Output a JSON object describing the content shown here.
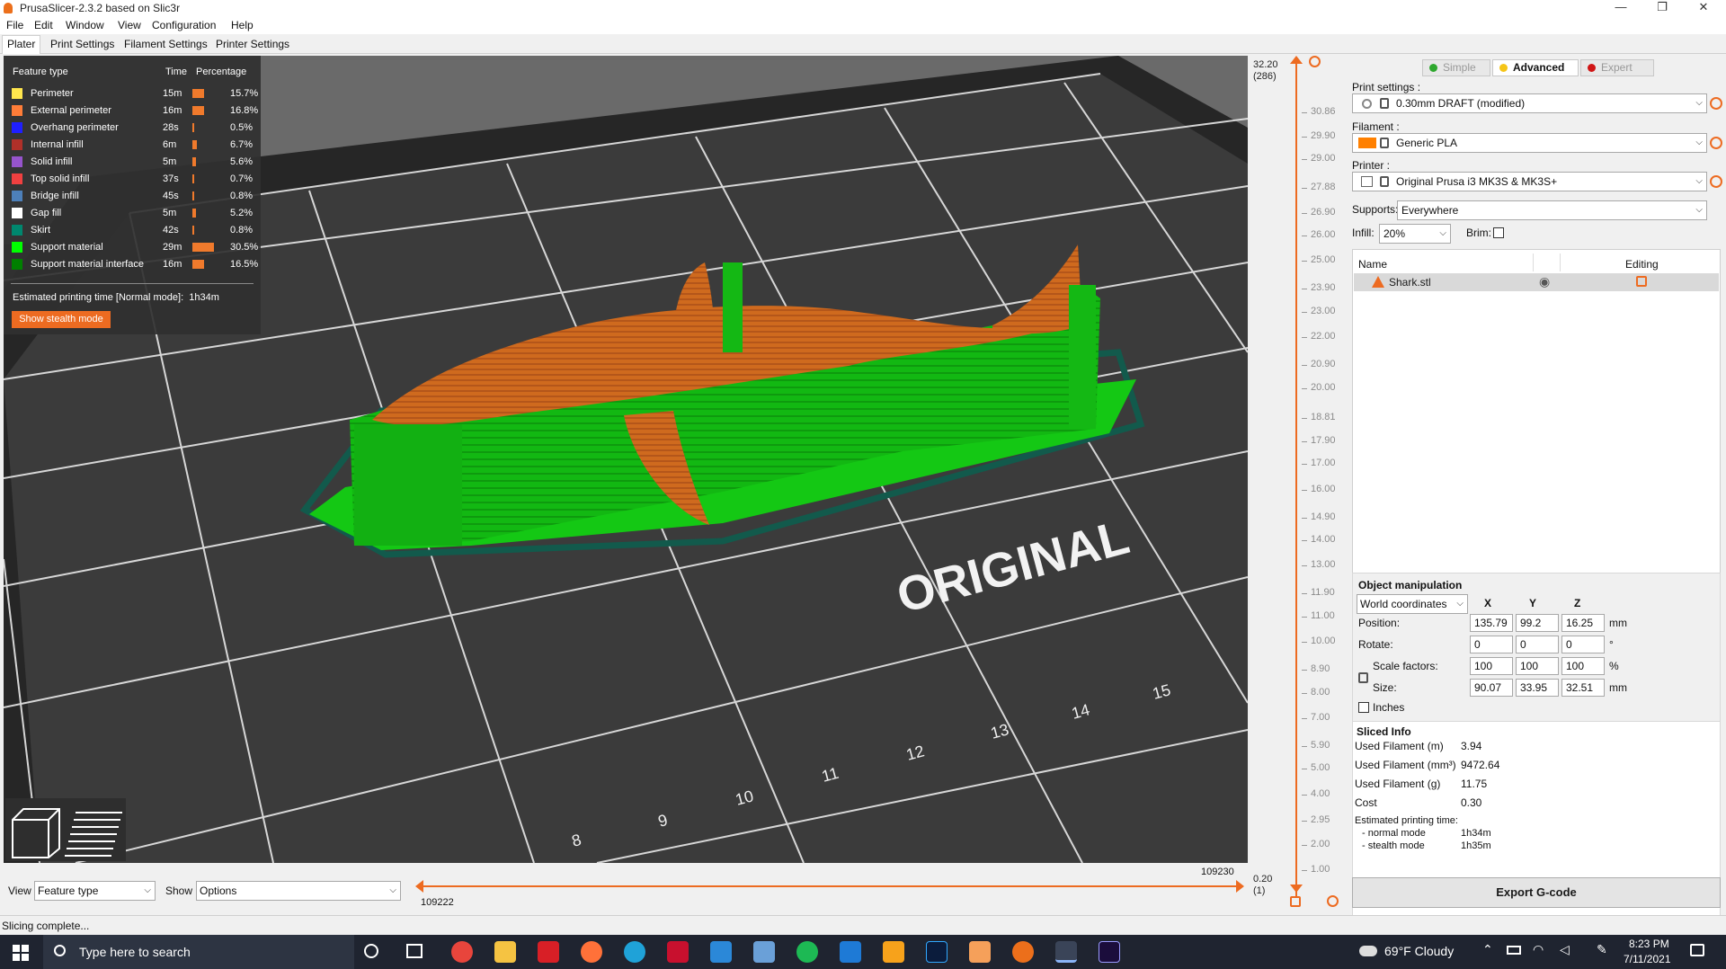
{
  "window": {
    "title": "PrusaSlicer-2.3.2 based on Slic3r",
    "controls": [
      "—",
      "❐",
      "✕"
    ]
  },
  "menu": [
    "File",
    "Edit",
    "Window",
    "View",
    "Configuration",
    "Help"
  ],
  "tabs": [
    "Plater",
    "Print Settings",
    "Filament Settings",
    "Printer Settings"
  ],
  "legend": {
    "headers": {
      "feature": "Feature type",
      "time": "Time",
      "percentage": "Percentage"
    },
    "rows": [
      {
        "name": "Perimeter",
        "time": "15m",
        "pct": "15.7%",
        "frac": 0.157,
        "color": "#ffe64d"
      },
      {
        "name": "External perimeter",
        "time": "16m",
        "pct": "16.8%",
        "frac": 0.168,
        "color": "#ff7d38"
      },
      {
        "name": "Overhang perimeter",
        "time": "28s",
        "pct": "0.5%",
        "frac": 0.005,
        "color": "#1f1fff"
      },
      {
        "name": "Internal infill",
        "time": "6m",
        "pct": "6.7%",
        "frac": 0.067,
        "color": "#b03029"
      },
      {
        "name": "Solid infill",
        "time": "5m",
        "pct": "5.6%",
        "frac": 0.056,
        "color": "#9654cc"
      },
      {
        "name": "Top solid infill",
        "time": "37s",
        "pct": "0.7%",
        "frac": 0.007,
        "color": "#f04040"
      },
      {
        "name": "Bridge infill",
        "time": "45s",
        "pct": "0.8%",
        "frac": 0.008,
        "color": "#4d80ba"
      },
      {
        "name": "Gap fill",
        "time": "5m",
        "pct": "5.2%",
        "frac": 0.052,
        "color": "#ffffff"
      },
      {
        "name": "Skirt",
        "time": "42s",
        "pct": "0.8%",
        "frac": 0.008,
        "color": "#00876e"
      },
      {
        "name": "Support material",
        "time": "29m",
        "pct": "30.5%",
        "frac": 0.305,
        "color": "#00ff00"
      },
      {
        "name": "Support material interface",
        "time": "16m",
        "pct": "16.5%",
        "frac": 0.165,
        "color": "#008000"
      }
    ],
    "estimated_label": "Estimated printing time [Normal mode]:",
    "estimated_value": "1h34m",
    "stealth_button": "Show stealth mode"
  },
  "viewport": {
    "bed_text": "ORIGINAL",
    "bed_numbers": [
      "8",
      "9",
      "10",
      "11",
      "12",
      "13",
      "14",
      "15"
    ]
  },
  "layer_slider": {
    "top_value": "32.20",
    "top_layer": "(286)",
    "bottom_value": "0.20",
    "bottom_layer": "(1)",
    "ticks": [
      "30.86",
      "29.90",
      "29.00",
      "27.88",
      "26.90",
      "26.00",
      "25.00",
      "23.90",
      "23.00",
      "22.00",
      "20.90",
      "20.00",
      "18.81",
      "17.90",
      "17.00",
      "16.00",
      "14.90",
      "14.00",
      "13.00",
      "11.90",
      "11.00",
      "10.00",
      "8.90",
      "8.00",
      "7.00",
      "5.90",
      "5.00",
      "4.00",
      "2.95",
      "2.00",
      "1.00"
    ]
  },
  "mode_buttons": [
    {
      "label": "Simple",
      "color": "#2ea82e",
      "active": false
    },
    {
      "label": "Advanced",
      "color": "#f5c518",
      "active": true
    },
    {
      "label": "Expert",
      "color": "#d01515",
      "active": false
    }
  ],
  "settings": {
    "print_label": "Print settings :",
    "print_value": "0.30mm DRAFT (modified)",
    "filament_label": "Filament :",
    "filament_value": "Generic PLA",
    "filament_color": "#ff8000",
    "printer_label": "Printer :",
    "printer_value": "Original Prusa i3 MK3S & MK3S+",
    "supports_label": "Supports:",
    "supports_value": "Everywhere",
    "infill_label": "Infill:",
    "infill_value": "20%",
    "brim_label": "Brim:"
  },
  "object_list": {
    "col_name": "Name",
    "col_editing": "Editing",
    "items": [
      {
        "name": "Shark.stl"
      }
    ]
  },
  "object_manipulation": {
    "title": "Object manipulation",
    "coord_system": "World coordinates",
    "axes": [
      "X",
      "Y",
      "Z"
    ],
    "position_label": "Position:",
    "position": [
      "135.79",
      "99.2",
      "16.25"
    ],
    "position_unit": "mm",
    "rotate_label": "Rotate:",
    "rotate": [
      "0",
      "0",
      "0"
    ],
    "rotate_unit": "°",
    "scale_label": "Scale factors:",
    "scale": [
      "100",
      "100",
      "100"
    ],
    "scale_unit": "%",
    "size_label": "Size:",
    "size": [
      "90.07",
      "33.95",
      "32.51"
    ],
    "size_unit": "mm",
    "inches_label": "Inches"
  },
  "sliced_info": {
    "title": "Sliced Info",
    "rows": [
      {
        "label": "Used Filament (m)",
        "value": "3.94"
      },
      {
        "label": "Used Filament (mm³)",
        "value": "9472.64"
      },
      {
        "label": "Used Filament (g)",
        "value": "11.75"
      },
      {
        "label": "Cost",
        "value": "0.30"
      }
    ],
    "time_label": "Estimated printing time:",
    "normal_label": "- normal mode",
    "normal_value": "1h34m",
    "stealth_label": "- stealth mode",
    "stealth_value": "1h35m"
  },
  "export_button": "Export G-code",
  "view_bar": {
    "view_label": "View",
    "view_value": "Feature type",
    "show_label": "Show",
    "show_value": "Options",
    "h_left": "109222",
    "h_right": "109230"
  },
  "status": "Slicing complete...",
  "taskbar": {
    "search_placeholder": "Type here to search",
    "weather": "69°F  Cloudy",
    "time": "8:23 PM",
    "date": "7/11/2021"
  }
}
